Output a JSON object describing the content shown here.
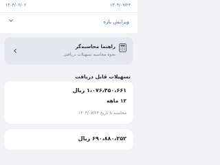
{
  "period": {
    "start_date": "۱۴۰۴/۰۷/۲۳",
    "end_date": "۱۴۰۴/۰۶/۰۶",
    "edit_label": "ویرایش بازه"
  },
  "guide": {
    "title": "راهنما محاسبه‌گر",
    "subtitle": "نحوه محاسبه تسهیلات دریافتی",
    "icon": "calculator-icon"
  },
  "facilities": {
    "section_title": "تسهیلات قابل دریافت",
    "items": [
      {
        "amount": "۱،۰۷۶،۴۵۰،۶۶۱ ریال",
        "term": "۱۲ ماهه",
        "note": "محاسبه تا تاریخ ۱۴۰۴/۰۷/۲۳"
      },
      {
        "amount": "۶۹۰،۸۸۰،۲۵۲ ریال"
      }
    ]
  },
  "colors": {
    "accent": "#2f6fd0",
    "background": "#f2f2f6",
    "card": "#ffffff",
    "guide_card": "#e5e7ee"
  }
}
